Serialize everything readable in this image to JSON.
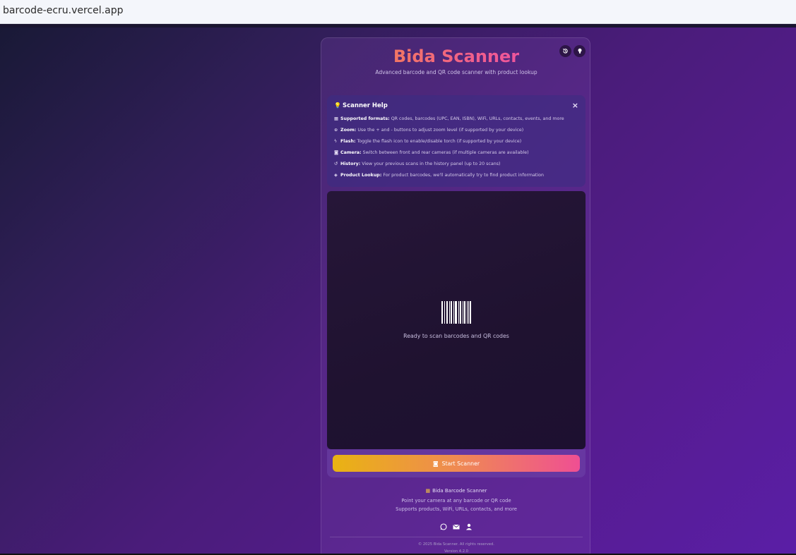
{
  "browser": {
    "url": "barcode-ecru.vercel.app"
  },
  "header": {
    "title": "Bida Scanner",
    "subtitle": "Advanced barcode and QR code scanner with product lookup",
    "history_icon": "history-icon",
    "tips_icon": "lightbulb-icon"
  },
  "help": {
    "title": "Scanner Help",
    "close": "×",
    "items": [
      {
        "icon": "grid-icon",
        "label": "Supported formats:",
        "text": " QR codes, barcodes (UPC, EAN, ISBN), WiFi, URLs, contacts, events, and more"
      },
      {
        "icon": "zoom-icon",
        "label": "Zoom:",
        "text": " Use the + and - buttons to adjust zoom level (if supported by your device)"
      },
      {
        "icon": "flash-icon",
        "label": "Flash:",
        "text": " Toggle the flash icon to enable/disable torch (if supported by your device)"
      },
      {
        "icon": "camera-icon",
        "label": "Camera:",
        "text": " Switch between front and rear cameras (if multiple cameras are available)"
      },
      {
        "icon": "history-icon",
        "label": "History:",
        "text": " View your previous scans in the history panel (up to 20 scans)"
      },
      {
        "icon": "box-icon",
        "label": "Product Lookup:",
        "text": " For product barcodes, we'll automatically try to find product information"
      }
    ]
  },
  "scanner": {
    "status": "Ready to scan barcodes and QR codes",
    "start_label": "Start Scanner"
  },
  "footer": {
    "title": "Bida Barcode Scanner",
    "line1": "Point your camera at any barcode or QR code",
    "line2": "Supports products, WiFi, URLs, contacts, and more",
    "social": [
      "whatsapp-icon",
      "email-icon",
      "user-icon"
    ],
    "copyright": "© 2025 Bida Scanner. All rights reserved.",
    "version": "Version 4.2.0"
  },
  "colors": {
    "accent_start": "#e9b312",
    "accent_end": "#ef4f93",
    "title_start": "#f38b3f",
    "title_end": "#e945b8"
  }
}
